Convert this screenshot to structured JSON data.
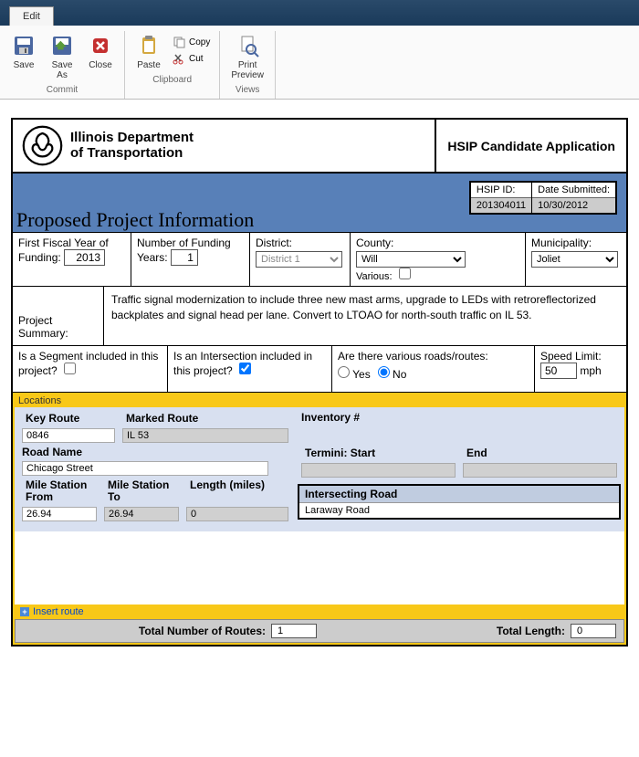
{
  "titlebar": {
    "tab": "Edit"
  },
  "ribbon": {
    "save": "Save",
    "saveAs": "Save\nAs",
    "close": "Close",
    "paste": "Paste",
    "copy": "Copy",
    "cut": "Cut",
    "print": "Print\nPreview",
    "group1": "Commit",
    "group2": "Clipboard",
    "group3": "Views"
  },
  "header": {
    "org1": "Illinois Department",
    "org2": "of Transportation",
    "appTitle": "HSIP Candidate Application"
  },
  "band": {
    "title": "Proposed Project Information",
    "hsipIdLbl": "HSIP ID:",
    "hsipId": "201304011",
    "dateLbl": "Date Submitted:",
    "date": "10/30/2012"
  },
  "r1": {
    "fyLbl": "First Fiscal Year of",
    "fyLbl2": "Funding:",
    "fy": "2013",
    "numLbl": "Number of Funding",
    "numLbl2": "Years:",
    "num": "1",
    "distLbl": "District:",
    "dist": "District 1",
    "cntyLbl": "County:",
    "cnty": "Will",
    "variousLbl": "Various:",
    "muniLbl": "Municipality:",
    "muni": "Joliet"
  },
  "summary": {
    "lbl": "Project Summary:",
    "text": "Traffic signal modernization to include three new mast arms, upgrade to LEDs with retroreflectorized backplates and signal head per lane. Convert to LTOAO for north-south traffic on IL 53."
  },
  "r2": {
    "segLbl": "Is a Segment included in this project?",
    "intLbl": "Is an Intersection included in this project?",
    "varLbl": "Are there various roads/routes:",
    "yes": "Yes",
    "no": "No",
    "speedLbl": "Speed Limit:",
    "speed": "50",
    "mph": "mph"
  },
  "loc": {
    "title": "Locations",
    "keyRoute": "Key Route",
    "keyRouteV": "0846",
    "markedRoute": "Marked Route",
    "markedRouteV": "IL 53",
    "inventory": "Inventory #",
    "roadName": "Road Name",
    "roadNameV": "Chicago Street",
    "terminiStart": "Termini: Start",
    "terminiEnd": "End",
    "msFrom": "Mile Station From",
    "msFromV": "26.94",
    "msTo": "Mile Station To",
    "msToV": "26.94",
    "length": "Length (miles)",
    "lengthV": "0",
    "intersecting": "Intersecting Road",
    "intersectingV": "Laraway Road",
    "insert": "Insert route"
  },
  "totals": {
    "numLbl": "Total Number of Routes:",
    "num": "1",
    "lenLbl": "Total Length:",
    "len": "0"
  }
}
